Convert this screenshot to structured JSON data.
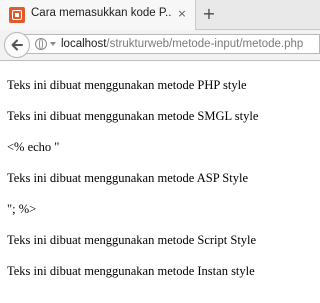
{
  "tab": {
    "title": "Cara memasukkan kode P...",
    "close": "×",
    "new_tab": "+"
  },
  "address_bar": {
    "host": "localhost",
    "path": "/strukturweb/metode-input/metode.php"
  },
  "content": {
    "lines": [
      "Teks ini dibuat menggunakan metode PHP style",
      "Teks ini dibuat menggunakan metode SMGL style",
      "<% echo \"",
      "Teks ini dibuat menggunakan metode ASP Style",
      "\"; %>",
      "Teks ini dibuat menggunakan metode Script Style",
      "Teks ini dibuat menggunakan metode Instan style"
    ]
  },
  "icons": {
    "favicon": "xampp-favicon-icon",
    "back": "back-arrow-icon",
    "site_info": "globe-icon",
    "history_dropdown": "dropdown-arrow-icon"
  }
}
